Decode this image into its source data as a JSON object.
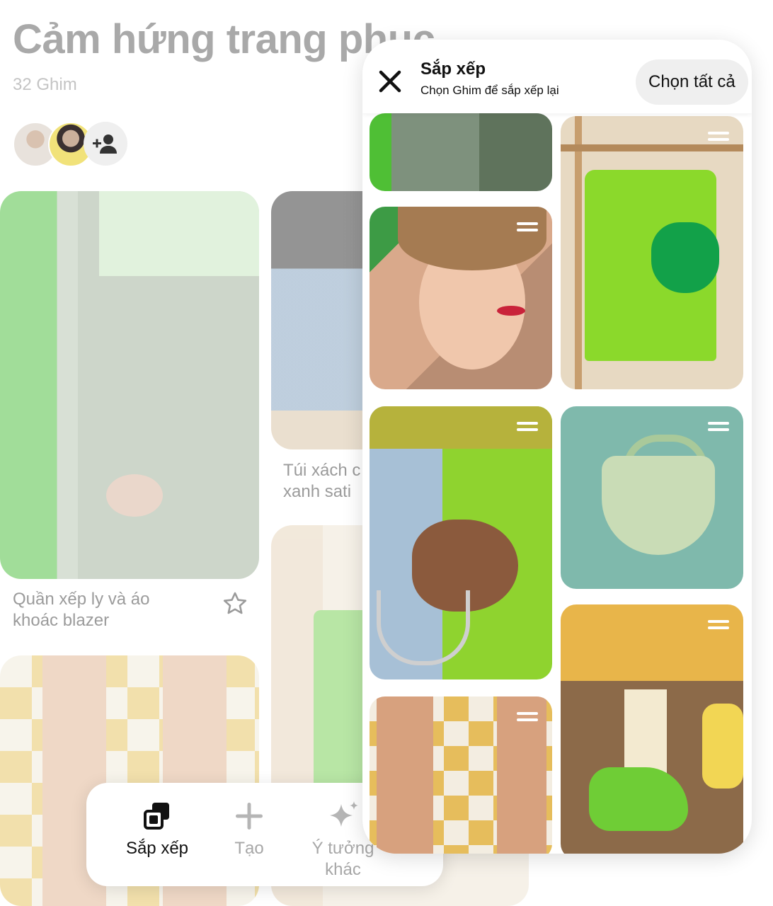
{
  "board": {
    "title": "Cảm hứng trang phục",
    "pin_count": "32 Ghim",
    "pins": [
      {
        "caption_line1": "Quần xếp ly và áo",
        "caption_line2": "khoác blazer"
      },
      {
        "caption_line1": "Túi xách c",
        "caption_line2": "xanh sati"
      }
    ]
  },
  "organize_panel": {
    "title": "Sắp xếp",
    "subtitle": "Chọn Ghim để sắp xếp lại",
    "select_all_label": "Chọn tất cả"
  },
  "toolbar": {
    "organize_label": "Sắp xếp",
    "create_label": "Tạo",
    "more_ideas_line1": "Ý tưởng",
    "more_ideas_line2": "khác"
  },
  "icons": {
    "close": "close-icon",
    "add_collaborator": "add-person-icon",
    "favorite": "star-icon",
    "organize": "organize-icon",
    "create": "plus-icon",
    "more_ideas": "sparkle-icon",
    "drag": "drag-handle-icon"
  },
  "colors": {
    "accent_green": "#8bd92b",
    "text_primary": "#111111",
    "text_muted": "#a7a7a7",
    "pill_bg": "#efefef"
  }
}
